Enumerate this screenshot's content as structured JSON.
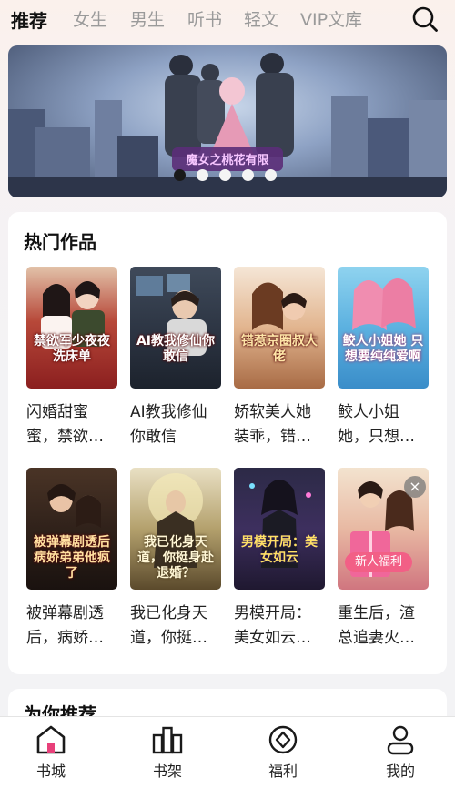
{
  "top_nav": {
    "tabs": [
      {
        "label": "推荐",
        "active": true
      },
      {
        "label": "女生"
      },
      {
        "label": "男生"
      },
      {
        "label": "听书"
      },
      {
        "label": "轻文"
      },
      {
        "label": "VIP文库"
      }
    ],
    "search_icon": "search-icon"
  },
  "banner": {
    "headline": "魔女之桃花有限",
    "dot_count": 5,
    "active_dot": 0
  },
  "hot": {
    "title": "热门作品",
    "books": [
      {
        "title": "闪婚甜蜜蜜，禁欲…",
        "cover_text": "禁欲军少夜夜洗床单"
      },
      {
        "title": "AI教我修仙你敢信",
        "cover_text": "AI教我修仙你敢信"
      },
      {
        "title": "娇软美人她装乖，错…",
        "cover_text": "错惹京圈叔大佬"
      },
      {
        "title": "鲛人小姐她，只想…",
        "cover_text": "鲛人小姐她 只想要纯纯爱啊"
      },
      {
        "title": "被弹幕剧透后，病娇…",
        "cover_text": "被弹幕剧透后 病娇弟弟他疯了"
      },
      {
        "title": "我已化身天道，你挺…",
        "cover_text": "我已化身天道，你挺身赴退婚？"
      },
      {
        "title": "男模开局：美女如云…",
        "cover_text": "男模开局：美女如云"
      },
      {
        "title": "重生后，渣总追妻火…",
        "cover_text": ""
      }
    ],
    "promo_label": "新人福利",
    "close_symbol": "×"
  },
  "recommend": {
    "title": "为你推荐"
  },
  "bottom_nav": [
    {
      "label": "书城",
      "icon": "home-icon",
      "active": true
    },
    {
      "label": "书架",
      "icon": "bookshelf-icon"
    },
    {
      "label": "福利",
      "icon": "gift-diamond-icon"
    },
    {
      "label": "我的",
      "icon": "profile-icon"
    }
  ],
  "colors": {
    "accent": "#e8407a",
    "active_tab": "#111111",
    "inactive_tab": "#9a9a9a",
    "promo": "#f25f86"
  }
}
